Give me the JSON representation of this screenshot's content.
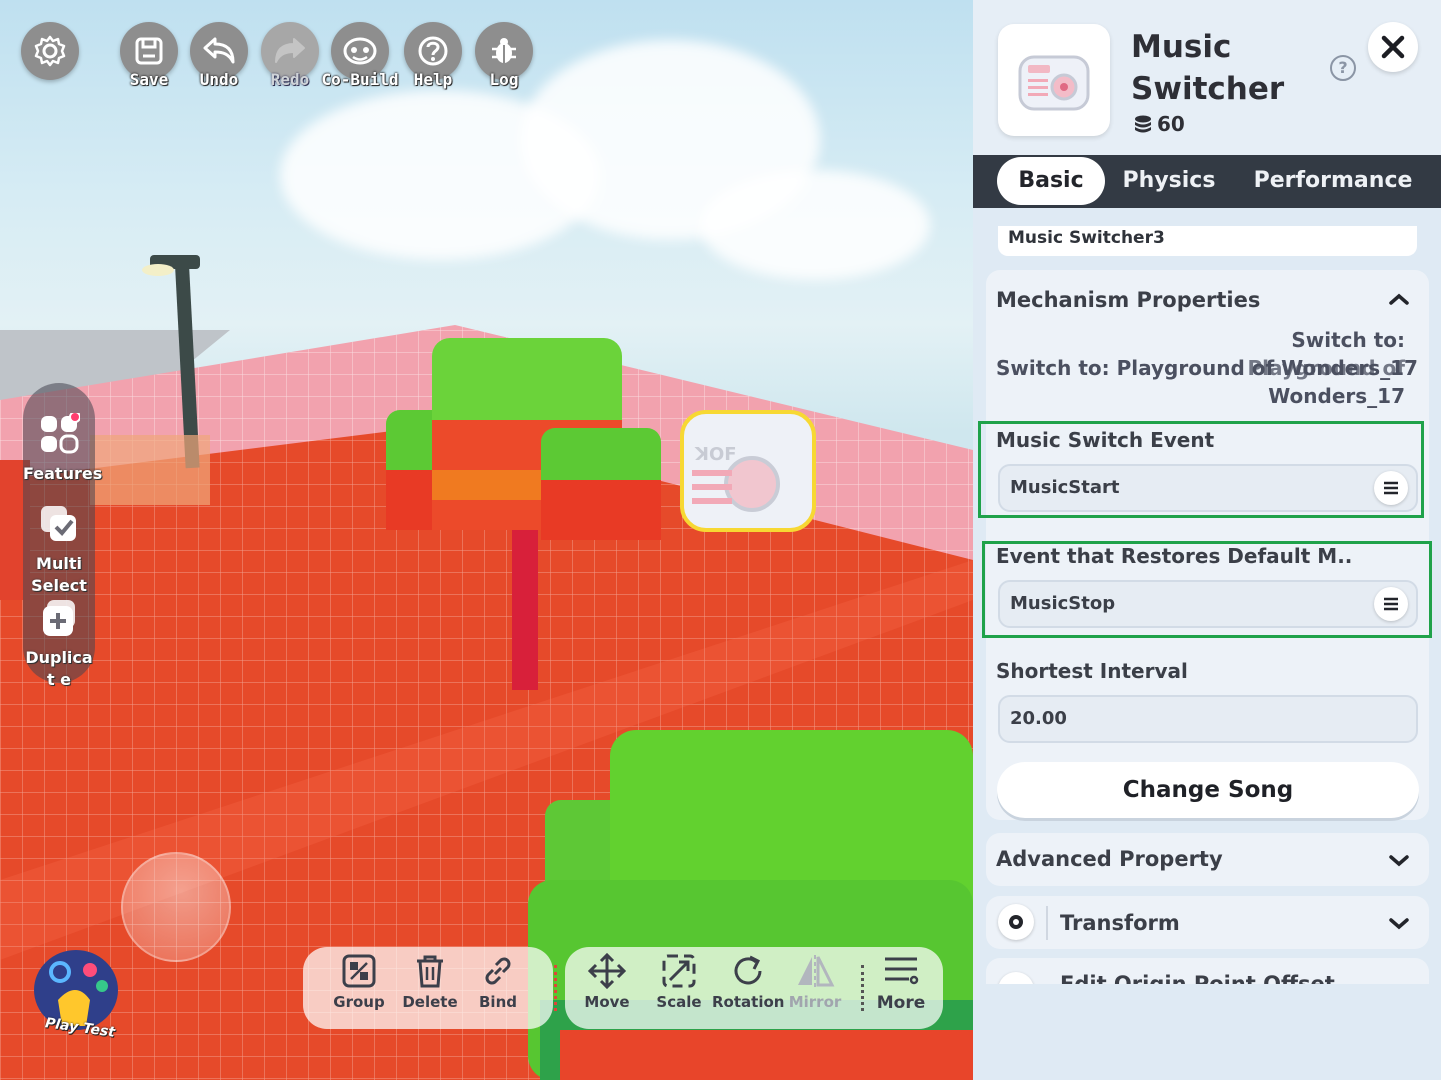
{
  "toolbar": {
    "items": [
      {
        "label": "",
        "icon": "gear-icon"
      },
      {
        "label": "Save",
        "icon": "save-icon"
      },
      {
        "label": "Undo",
        "icon": "undo-icon"
      },
      {
        "label": "Redo",
        "icon": "redo-icon"
      },
      {
        "label": "Co-Build",
        "icon": "co-build-icon"
      },
      {
        "label": "Help",
        "icon": "help-icon"
      },
      {
        "label": "Log",
        "icon": "log-bug-icon"
      }
    ]
  },
  "sidebar": {
    "items": [
      {
        "label": "Features",
        "icon": "features-icon"
      },
      {
        "label": "Multi Select",
        "icon": "multi-select-icon"
      },
      {
        "label": "Duplicat e",
        "icon": "duplicate-icon"
      }
    ]
  },
  "play": {
    "label": "Play Test"
  },
  "bottombar": {
    "items": [
      {
        "label": "Group",
        "icon": "group-icon"
      },
      {
        "label": "Delete",
        "icon": "trash-icon"
      },
      {
        "label": "Bind",
        "icon": "link-icon"
      },
      {
        "label": "Move",
        "icon": "move-icon"
      },
      {
        "label": "Scale",
        "icon": "scale-icon"
      },
      {
        "label": "Rotation",
        "icon": "rotate-icon"
      },
      {
        "label": "Mirror",
        "icon": "mirror-icon"
      },
      {
        "label": "More",
        "icon": "more-icon"
      }
    ]
  },
  "panel": {
    "title": "Music Switcher",
    "cost": "60",
    "tabs": [
      "Basic",
      "Physics",
      "Performance"
    ],
    "active_tab": "Basic",
    "name_value": "Music Switcher3",
    "mechanism": {
      "title": "Mechanism Properties",
      "switch_left": "Switch to: Playground of Wonders_17",
      "switch_overlay_1": "Switch to:",
      "switch_overlay_2": "Playground of",
      "switch_overlay_3": "Wonders_17",
      "music_switch_event_label": "Music Switch Event",
      "music_switch_event_value": "MusicStart",
      "restore_event_label": "Event that Restores Default M..",
      "restore_event_value": "MusicStop",
      "interval_label": "Shortest Interval",
      "interval_value": "20.00",
      "change_song": "Change Song"
    },
    "advanced": "Advanced Property",
    "transform": "Transform",
    "edit_origin": "Edit Origin Point Offset"
  },
  "colors": {
    "highlight": "#1fa24a",
    "tab_bar": "#333a44",
    "floor": "#e64a2a"
  }
}
